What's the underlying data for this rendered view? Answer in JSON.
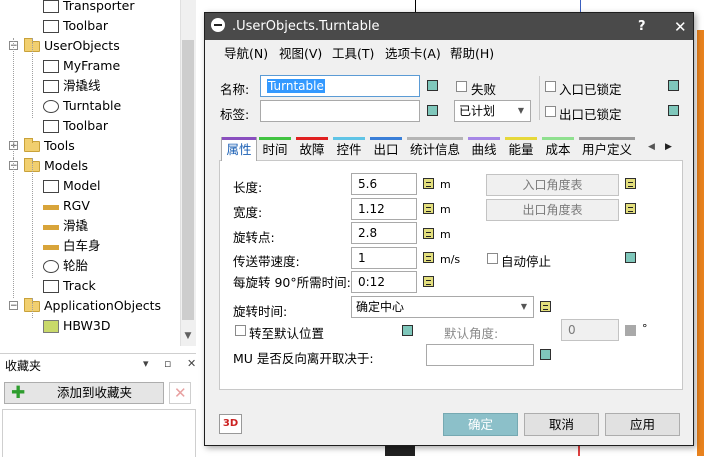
{
  "tree": {
    "items": [
      {
        "label": "Transporter",
        "level": 2,
        "icon": "transporter-icon"
      },
      {
        "label": "Toolbar",
        "level": 2,
        "icon": "toolbar-icon"
      },
      {
        "label": "UserObjects",
        "level": 1,
        "icon": "folder-icon",
        "expanded": true
      },
      {
        "label": "MyFrame",
        "level": 2,
        "icon": "frame-icon"
      },
      {
        "label": "滑撬线",
        "level": 2,
        "icon": "line-icon"
      },
      {
        "label": "Turntable",
        "level": 2,
        "icon": "turntable-icon"
      },
      {
        "label": "Toolbar",
        "level": 2,
        "icon": "toolbar-icon"
      },
      {
        "label": "Tools",
        "level": 1,
        "icon": "folder-icon",
        "expanded": false
      },
      {
        "label": "Models",
        "level": 1,
        "icon": "folder-icon",
        "expanded": true
      },
      {
        "label": "Model",
        "level": 2,
        "icon": "model-icon"
      },
      {
        "label": "RGV",
        "level": 2,
        "icon": "rgv-icon"
      },
      {
        "label": "滑撬",
        "level": 2,
        "icon": "skid-icon"
      },
      {
        "label": "白车身",
        "level": 2,
        "icon": "car-body-icon"
      },
      {
        "label": "轮胎",
        "level": 2,
        "icon": "tire-icon"
      },
      {
        "label": "Track",
        "level": 2,
        "icon": "track-icon"
      },
      {
        "label": "ApplicationObjects",
        "level": 1,
        "icon": "folder-icon",
        "expanded": true
      },
      {
        "label": "HBW3D",
        "level": 2,
        "icon": "hbw3d-icon"
      }
    ]
  },
  "favorites": {
    "title": "收藏夹",
    "add_label": "添加到收藏夹"
  },
  "dialog": {
    "title": ".UserObjects.Turntable",
    "help": "?",
    "close": "✕",
    "menu": [
      "导航(N)",
      "视图(V)",
      "工具(T)",
      "选项卡(A)",
      "帮助(H)"
    ],
    "name_label": "名称:",
    "name_value": "Turntable",
    "tag_label": "标签:",
    "tag_value": "",
    "failed_label": "失败",
    "planned_value": "已计划",
    "entry_locked_label": "入口已锁定",
    "exit_locked_label": "出口已锁定",
    "tabs": [
      {
        "label": "属性",
        "color": "#8a4fbf"
      },
      {
        "label": "时间",
        "color": "#41c341"
      },
      {
        "label": "故障",
        "color": "#e02020"
      },
      {
        "label": "控件",
        "color": "#5fc4e6"
      },
      {
        "label": "出口",
        "color": "#3a7fd8"
      },
      {
        "label": "统计信息",
        "color": "#b5b5b5"
      },
      {
        "label": "曲线",
        "color": "#a687e6"
      },
      {
        "label": "能量",
        "color": "#e6d83a"
      },
      {
        "label": "成本",
        "color": "#8fe08f"
      },
      {
        "label": "用户定义",
        "color": "#9a9a9a"
      }
    ],
    "props": {
      "length_label": "长度:",
      "length_value": "5.6",
      "length_unit": "m",
      "width_label": "宽度:",
      "width_value": "1.12",
      "width_unit": "m",
      "pivot_label": "旋转点:",
      "pivot_value": "2.8",
      "pivot_unit": "m",
      "conveyor_speed_label": "传送带速度:",
      "conveyor_speed_value": "1",
      "conveyor_speed_unit": "m/s",
      "rotate_time_label": "每旋转 90°所需时间:",
      "rotate_time_value": "0:12",
      "rotation_time_label": "旋转时间:",
      "rotation_time_value": "确定中心",
      "entry_angle_table": "入口角度表",
      "exit_angle_table": "出口角度表",
      "auto_stop_label": "自动停止",
      "to_default_label": "转至默认位置",
      "default_angle_label": "默认角度:",
      "default_angle_value": "0",
      "default_angle_unit": "°",
      "mu_reverse_label": "MU 是否反向离开取决于:",
      "mu_reverse_value": ""
    },
    "buttons": {
      "ok": "确定",
      "cancel": "取消",
      "apply": "应用",
      "three_d": "3D"
    }
  },
  "colors": {
    "titlebar": "#4a4a4a",
    "accent": "#7fc7bb",
    "ok_button": "#8cc0c9"
  }
}
